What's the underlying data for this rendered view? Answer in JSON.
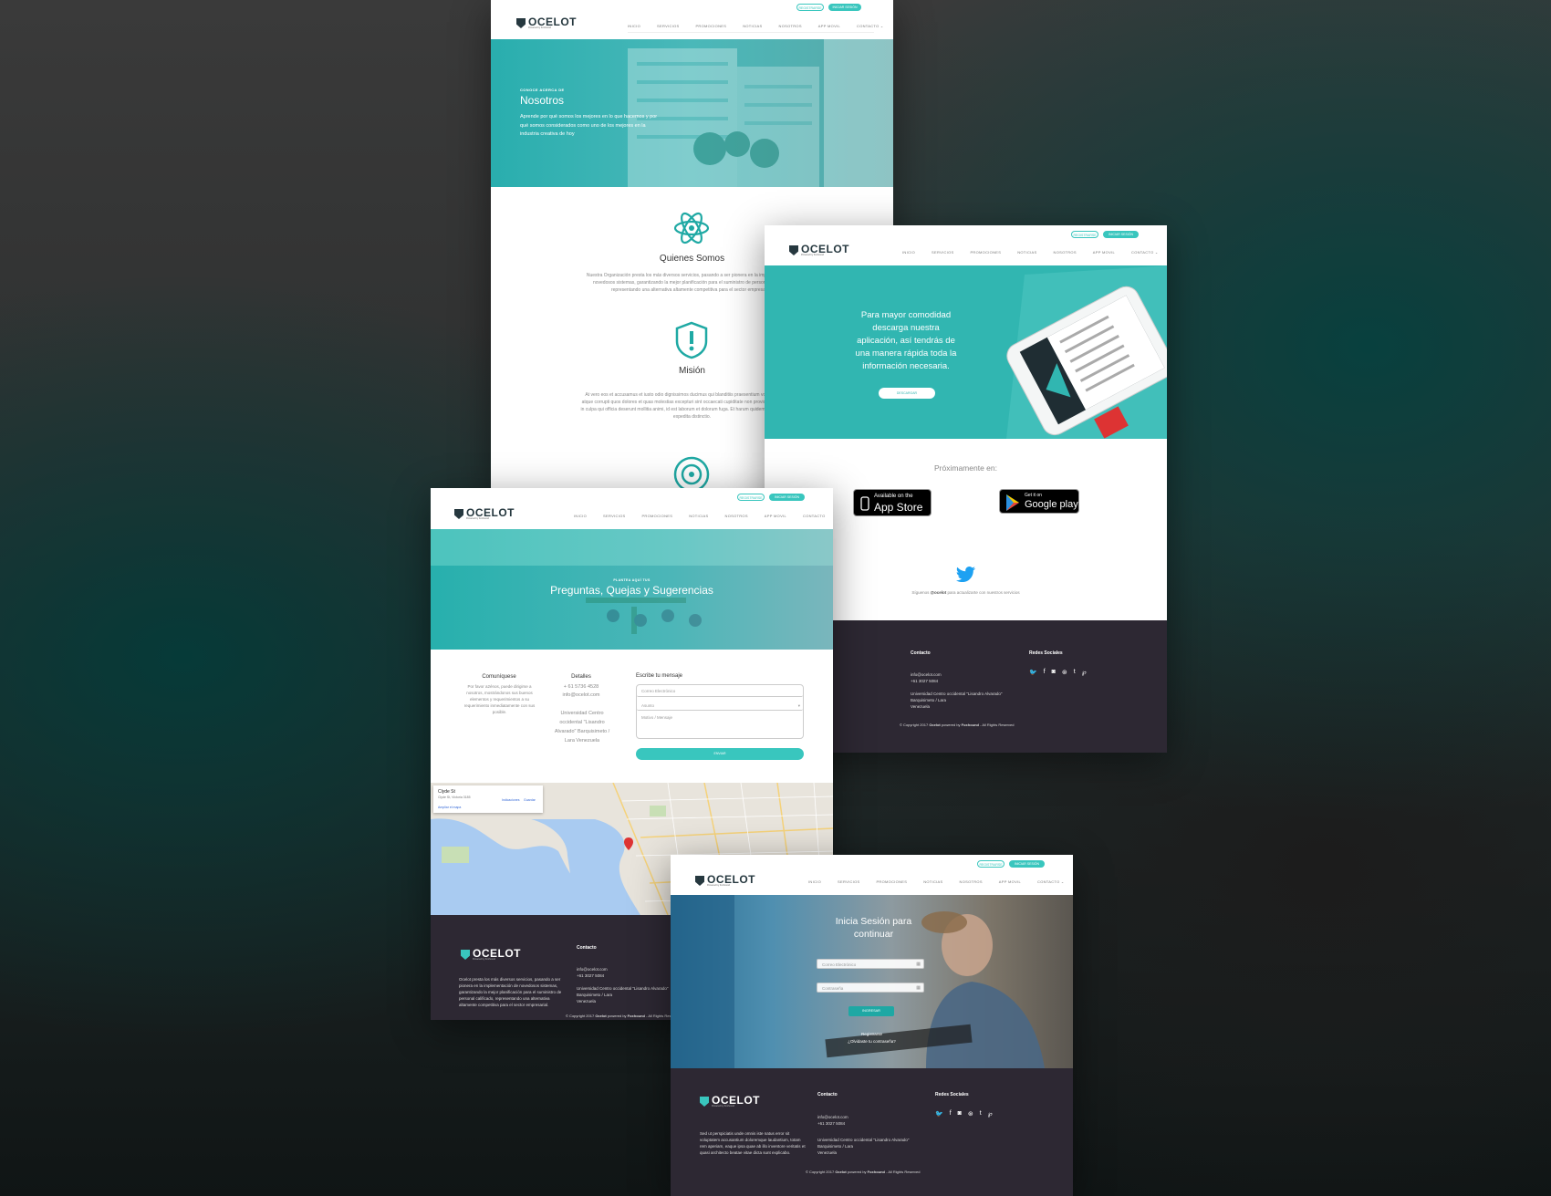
{
  "brand": {
    "name": "OCELOT",
    "tagline": "Powered by Foxhound"
  },
  "header": {
    "btn_register": "REGISTRARSE",
    "btn_login": "INICIAR SESIÓN",
    "nav": [
      "INICIO",
      "SERVICIOS",
      "PROMOCIONES",
      "NOTICIAS",
      "NOSOTROS",
      "APP MOVIL",
      "CONTACTO"
    ],
    "nav_contact_dropdown": "CONTACTO ⌄"
  },
  "about": {
    "eyebrow": "CONOCE ACERCA DE",
    "title": "Nosotros",
    "intro": "Aprende por qué somos los mejores en lo que hacemos y por qué somos considerados como uno de los mejores en la industria creativa de hoy",
    "s1_title": "Quienes Somos",
    "s1_text": "Nuestra Organización presta los más diversos servicios, pasando a ser pionera en la implementación de novedosos sistemas, garantizando la mejor planificación para el suministro de personal calificado, representando una alternativa altamente competitiva para el sector empresarial.",
    "s2_title": "Misión",
    "s2_text": "At vero eos et accusamus et iusto odio dignissimos ducimus qui blanditiis praesentium voluptatum deleniti atque corrupti quos dolores et quas molestias excepturi sint occaecati cupiditate non provident, similique sunt in culpa qui officia deserunt mollitia animi, id est laborum et dolorum fuga. Et harum quidem rerum facilis est et expedita distinctio."
  },
  "app": {
    "headline": "Para mayor comodidad descarga nuestra aplicación, así tendrás de una manera rápida toda la información necesaria.",
    "download_btn": "DESCARGAR",
    "soon": "Próximamente en:",
    "appstore_top": "Available on the",
    "appstore_name": "App Store",
    "gplay_top": "Get it on",
    "gplay_name": "Google play",
    "twitter_prefix": "Síguenos ",
    "twitter_handle": "@ocelot",
    "twitter_suffix": " para actualizarte con nuestros servicios"
  },
  "contact": {
    "eyebrow": "PLANTEA AQUÍ TUS",
    "title": "Preguntas, Quejas y Sugerencias",
    "col1_title": "Comuníquese",
    "col1_text": "Por favor a2énos, puede dirigirse a nosotros, mostrándonos sus buenos elementos y requerimientos a su requerimiento inmediatamente con sus posible.",
    "col2_title": "Detalles",
    "phone": "+ 61 5736 4528",
    "email": "info@ocelot.com",
    "address": "Universidad Centro occidental \"Lisandro Alvarado\" Barquisimeto / Lara Venezuela",
    "form_title": "Escribe tu mensaje",
    "field_email": "Correo Electrónico",
    "field_subject": "Asunto",
    "field_message": "Motivo / Mensaje",
    "send_btn": "ENVIAR",
    "map_place": "Clyde St",
    "map_sub": "Clyde St, Victoria 3185",
    "map_link": "Ampliar el mapa",
    "map_dir": "Indicaciones",
    "map_save": "Guardar"
  },
  "login": {
    "title": "Inicia Sesión para continuar",
    "field_email": "Correo Electrónico",
    "field_password": "Contraseña",
    "btn": "INGRESAR",
    "register_link": "Registrarse",
    "forgot_link": "¿Olvidaste tu contraseña?"
  },
  "footer": {
    "contact_title": "Contacto",
    "social_title": "Redes Sociales",
    "email": "info@ocelot.com",
    "phone": "+61 3027 5084",
    "addr1": "Universidad Centro occidental \"Lisandro Alvarado\"",
    "addr2": "Barquisimeto / Lara",
    "addr3": "Venezuela",
    "about_text": "Ocelot presta los más diversos servicios, pasando a ser pionera en la implementación de novedosos sistemas, garantizando la mejor planificación para el suministro de personal calificado, representando una alternativa altamente competitiva para el sector empresarial.",
    "about_text_b": "Sed ut perspiciatis unde omnis iste natus error sit voluptatem accusantium doloremque laudantium, totam rem aperiam, eaque ipsa quae ab illo inventore veritatis et quasi architecto beatae vitae dicta sunt explicabo.",
    "copy_prefix": "© Copyright 2017 ",
    "copy_brand": "Ocelot",
    "copy_mid": " powered by ",
    "copy_by": "Foxhound",
    "copy_suffix": " - All Rights Reserved"
  },
  "colors": {
    "teal": "#39c6be",
    "dark": "#2d2833",
    "navy": "#26383f"
  },
  "icons": {
    "social": [
      "twitter-icon",
      "facebook-icon",
      "instagram-icon",
      "dribbble-icon",
      "tumblr-icon",
      "pinterest-icon"
    ]
  }
}
